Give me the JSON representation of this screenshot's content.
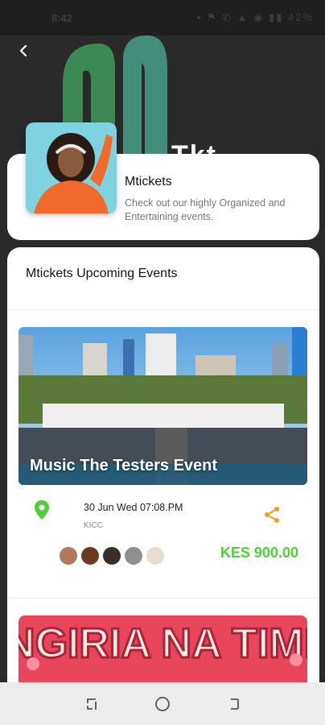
{
  "status_bar": {
    "time": "8:42",
    "icons": "• ⚑ ✆ ▲ ◉ ▮▮ 42%"
  },
  "header": {
    "logo_text": "Tkt"
  },
  "organizer": {
    "name": "Mtickets",
    "description": "Check out our highly Organized and Entertaining events."
  },
  "events_section": {
    "title": "Mtickets Upcoming Events",
    "events": [
      {
        "name": "Music The Testers Event",
        "datetime": "30 Jun Wed 07:08.PM",
        "venue": "KICC",
        "price": "KES 900.00",
        "attendee_count": 5
      },
      {
        "name_art": "INGIRIA NA TIME"
      }
    ]
  },
  "colors": {
    "accent_green": "#4cd137",
    "share_orange": "#f0a020",
    "pin_green": "#4cd137"
  },
  "icons": [
    "back-arrow-icon",
    "location-pin-icon",
    "share-icon",
    "recent-apps-icon",
    "home-icon",
    "back-nav-icon"
  ]
}
